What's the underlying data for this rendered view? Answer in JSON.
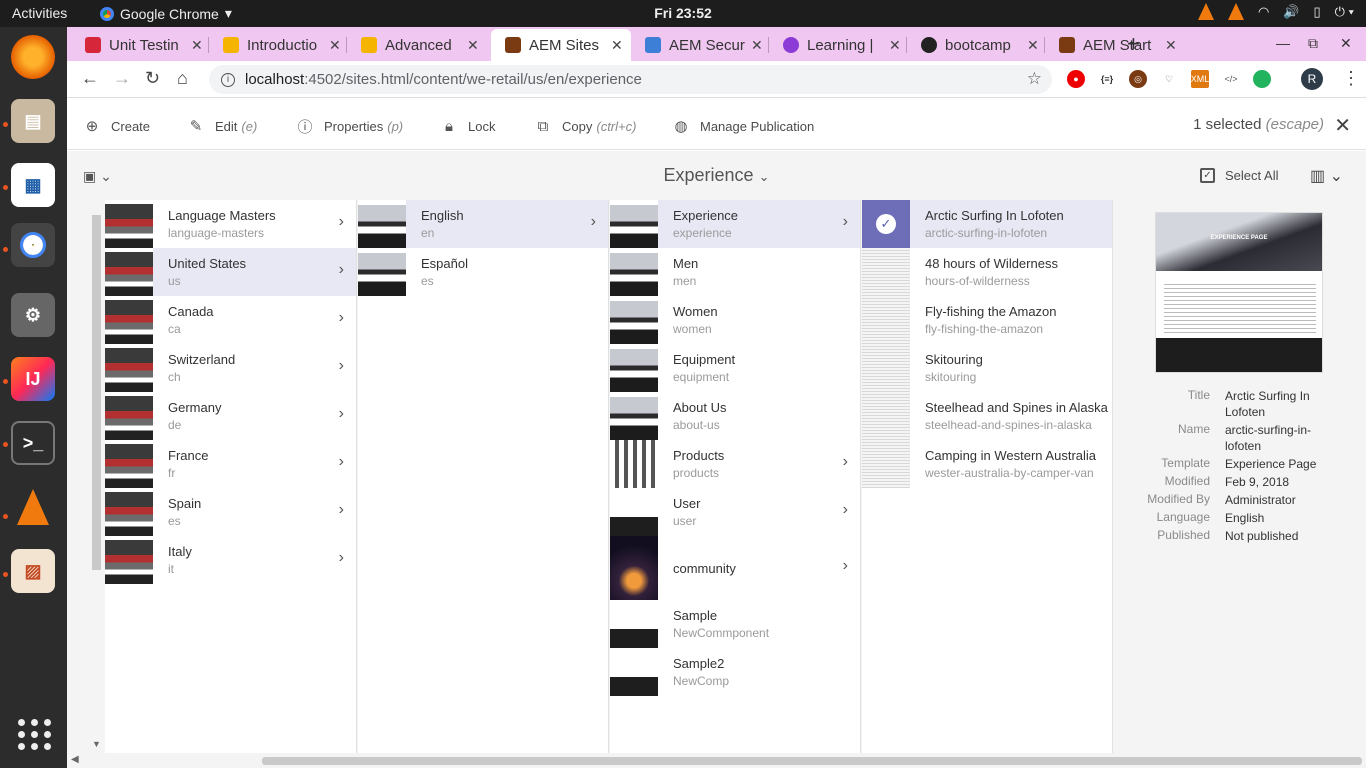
{
  "system": {
    "activities": "Activities",
    "app_menu": "Google Chrome",
    "clock": "Fri 23:52"
  },
  "browser": {
    "tabs": [
      {
        "label": "Unit Testin",
        "color": "#d6263a"
      },
      {
        "label": "Introductio",
        "color": "#f4b400"
      },
      {
        "label": "Advanced",
        "color": "#f4b400"
      },
      {
        "label": "AEM Sites",
        "color": "#7a3b12"
      },
      {
        "label": "AEM Secur",
        "color": "#3d7fd6"
      },
      {
        "label": "Learning |",
        "color": "#8d3bd6"
      },
      {
        "label": "bootcamp",
        "color": "#222222"
      },
      {
        "label": "AEM Start",
        "color": "#7a3b12"
      }
    ],
    "new_tab": "+",
    "url_host": "localhost",
    "url_path": ":4502/sites.html/content/we-retail/us/en/experience",
    "profile_initial": "R"
  },
  "actions": {
    "create": "Create",
    "edit": "Edit",
    "edit_hint": "(e)",
    "properties": "Properties",
    "properties_hint": "(p)",
    "lock": "Lock",
    "copy": "Copy",
    "copy_hint": "(ctrl+c)",
    "manage_publication": "Manage Publication",
    "selected_count": "1 selected",
    "selected_hint": "(escape)"
  },
  "titlebar": {
    "title": "Experience",
    "select_all": "Select All"
  },
  "columns": {
    "col1": [
      {
        "title": "Language Masters",
        "name": "language-masters"
      },
      {
        "title": "United States",
        "name": "us"
      },
      {
        "title": "Canada",
        "name": "ca"
      },
      {
        "title": "Switzerland",
        "name": "ch"
      },
      {
        "title": "Germany",
        "name": "de"
      },
      {
        "title": "France",
        "name": "fr"
      },
      {
        "title": "Spain",
        "name": "es"
      },
      {
        "title": "Italy",
        "name": "it"
      }
    ],
    "col2": [
      {
        "title": "English",
        "name": "en"
      },
      {
        "title": "Español",
        "name": "es"
      }
    ],
    "col3": [
      {
        "title": "Experience",
        "name": "experience"
      },
      {
        "title": "Men",
        "name": "men"
      },
      {
        "title": "Women",
        "name": "women"
      },
      {
        "title": "Equipment",
        "name": "equipment"
      },
      {
        "title": "About Us",
        "name": "about-us"
      },
      {
        "title": "Products",
        "name": "products"
      },
      {
        "title": "User",
        "name": "user"
      },
      {
        "title": "community",
        "name": ""
      },
      {
        "title": "Sample",
        "name": "NewCommponent"
      },
      {
        "title": "Sample2",
        "name": "NewComp"
      }
    ],
    "col4": [
      {
        "title": "Arctic Surfing In Lofoten",
        "name": "arctic-surfing-in-lofoten"
      },
      {
        "title": "48 hours of Wilderness",
        "name": "hours-of-wilderness"
      },
      {
        "title": "Fly-fishing the Amazon",
        "name": "fly-fishing-the-amazon"
      },
      {
        "title": "Skitouring",
        "name": "skitouring"
      },
      {
        "title": "Steelhead and Spines in Alaska",
        "name": "steelhead-and-spines-in-alaska"
      },
      {
        "title": "Camping in Western Australia",
        "name": "wester-australia-by-camper-van"
      }
    ]
  },
  "meta": {
    "preview_title": "EXPERIENCE PAGE",
    "rows": [
      {
        "label": "Title",
        "value": "Arctic Surfing In Lofoten"
      },
      {
        "label": "Name",
        "value": "arctic-surfing-in-lofoten"
      },
      {
        "label": "Template",
        "value": "Experience Page"
      },
      {
        "label": "Modified",
        "value": "Feb 9, 2018"
      },
      {
        "label": "Modified By",
        "value": "Administrator"
      },
      {
        "label": "Language",
        "value": "English"
      },
      {
        "label": "Published",
        "value": "Not published"
      }
    ]
  }
}
